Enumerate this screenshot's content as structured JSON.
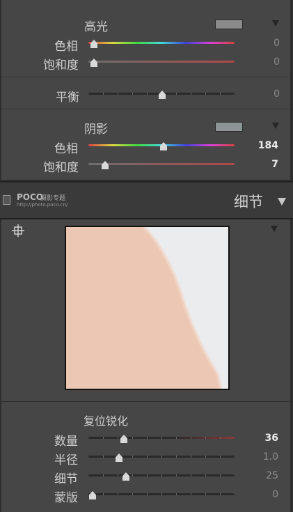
{
  "split_toning": {
    "highlights": {
      "title": "高光",
      "swatch_color": "#8a8a8a",
      "hue": {
        "label": "色相",
        "value": "0",
        "level": 0.0
      },
      "saturation": {
        "label": "饱和度",
        "value": "0",
        "level": 0.0
      }
    },
    "balance": {
      "label": "平衡",
      "value": "0",
      "level": 0.5
    },
    "shadows": {
      "title": "阴影",
      "swatch_color": "#8e9597",
      "hue": {
        "label": "色相",
        "value": "184",
        "level": 0.51
      },
      "saturation": {
        "label": "饱和度",
        "value": "7",
        "level": 0.07
      }
    }
  },
  "detail_panel": {
    "watermark_brand": "POCO",
    "watermark_sub": "摄影专题",
    "watermark_url": "http://photo.poco.cn/",
    "title": "细节",
    "sharpening": {
      "title": "复位锐化",
      "amount": {
        "label": "数量",
        "value": "36",
        "level": 0.24
      },
      "radius": {
        "label": "半径",
        "value": "1.0",
        "level": 0.2
      },
      "detail": {
        "label": "细节",
        "value": "25",
        "level": 0.25
      },
      "masking": {
        "label": "蒙版",
        "value": "0",
        "level": 0.0
      }
    }
  },
  "colors": {
    "panel_bg": "#464646",
    "preview_skin": "#ecc8b4",
    "preview_bg": "#eaecee"
  }
}
